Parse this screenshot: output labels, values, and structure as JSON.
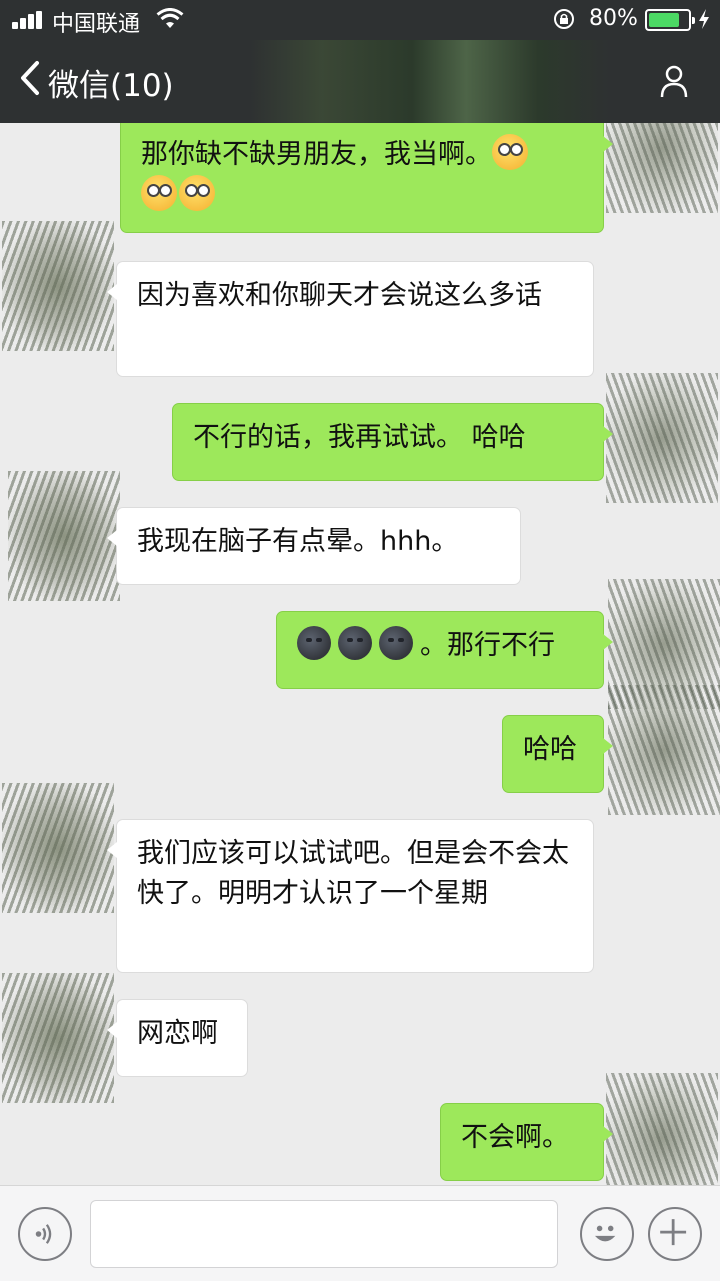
{
  "status_bar": {
    "carrier": "中国联通",
    "battery_percent": "80%",
    "battery_level": 0.8,
    "icons": [
      "signal-icon",
      "wifi-icon",
      "rotation-lock-icon",
      "battery-icon",
      "charging-bolt-icon"
    ]
  },
  "nav": {
    "back_label": "微信(10)",
    "icons": [
      "chevron-left-icon",
      "person-icon"
    ]
  },
  "messages": [
    {
      "side": "out",
      "text": "那你缺不缺男朋友，我当啊。",
      "emoji": [
        "peek-emoji",
        "peek-emoji",
        "peek-emoji"
      ]
    },
    {
      "side": "in",
      "text": "因为喜欢和你聊天才会说这么多话"
    },
    {
      "side": "out",
      "text": "不行的话，我再试试。 哈哈"
    },
    {
      "side": "in",
      "text": "我现在脑子有点晕。hhh。"
    },
    {
      "side": "out",
      "text": "。那行不行",
      "emoji": [
        "new-moon-face-emoji",
        "new-moon-face-emoji",
        "new-moon-face-emoji"
      ]
    },
    {
      "side": "out",
      "text": "哈哈"
    },
    {
      "side": "in",
      "text": "我们应该可以试试吧。但是会不会太快了。明明才认识了一个星期"
    },
    {
      "side": "in",
      "text": "网恋啊"
    },
    {
      "side": "out",
      "text": "不会啊。"
    }
  ],
  "input_bar": {
    "value": "",
    "icons": [
      "voice-icon",
      "emoji-icon",
      "plus-icon"
    ]
  },
  "colors": {
    "nav_bg": "#2e3132",
    "chat_bg": "#ececec",
    "outgoing_bubble": "#9de85b",
    "incoming_bubble": "#ffffff",
    "battery_fill": "#4cd964"
  }
}
